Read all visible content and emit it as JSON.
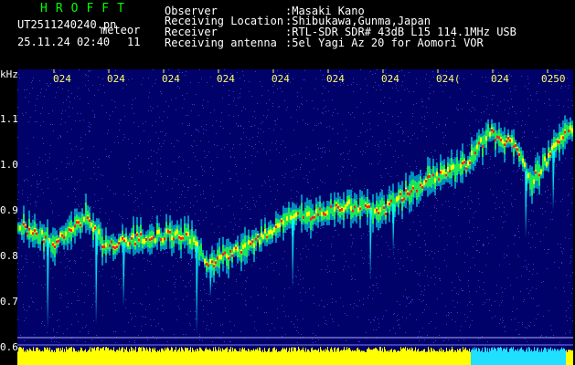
{
  "header": {
    "app_title": "HROFFT",
    "file_name": "UT2511240240.pn",
    "mode": "meteor",
    "date_time": "25.11.24 02:40",
    "count": "11",
    "info": [
      {
        "label": "Observer",
        "value": ":Masaki Kano"
      },
      {
        "label": "Receiving Location",
        "value": ":Shibukawa,Gunma,Japan"
      },
      {
        "label": "Receiver",
        "value": ":RTL-SDR SDR# 43dB L15 114.1MHz USB"
      },
      {
        "label": "Receiving antenna",
        "value": ":5el Yagi Az 20 for Aomori VOR"
      }
    ]
  },
  "plot": {
    "y_unit": "kHz",
    "y_ticks": [
      "1.1",
      "1.0",
      "0.9",
      "0.8",
      "0.7",
      "0.6"
    ],
    "x_ticks": [
      "024",
      "024",
      "024",
      "024",
      "024",
      "024",
      "024",
      "024(",
      "024",
      "0250"
    ],
    "colors": {
      "background": "#01016a",
      "trace_red": "#ff2020",
      "trace_yellow": "#ffff00",
      "trace_green": "#20ff40",
      "trace_cyan": "#00ffff",
      "power_bar": "#ffff00",
      "power_bar_alt": "#20e0ff"
    }
  }
}
